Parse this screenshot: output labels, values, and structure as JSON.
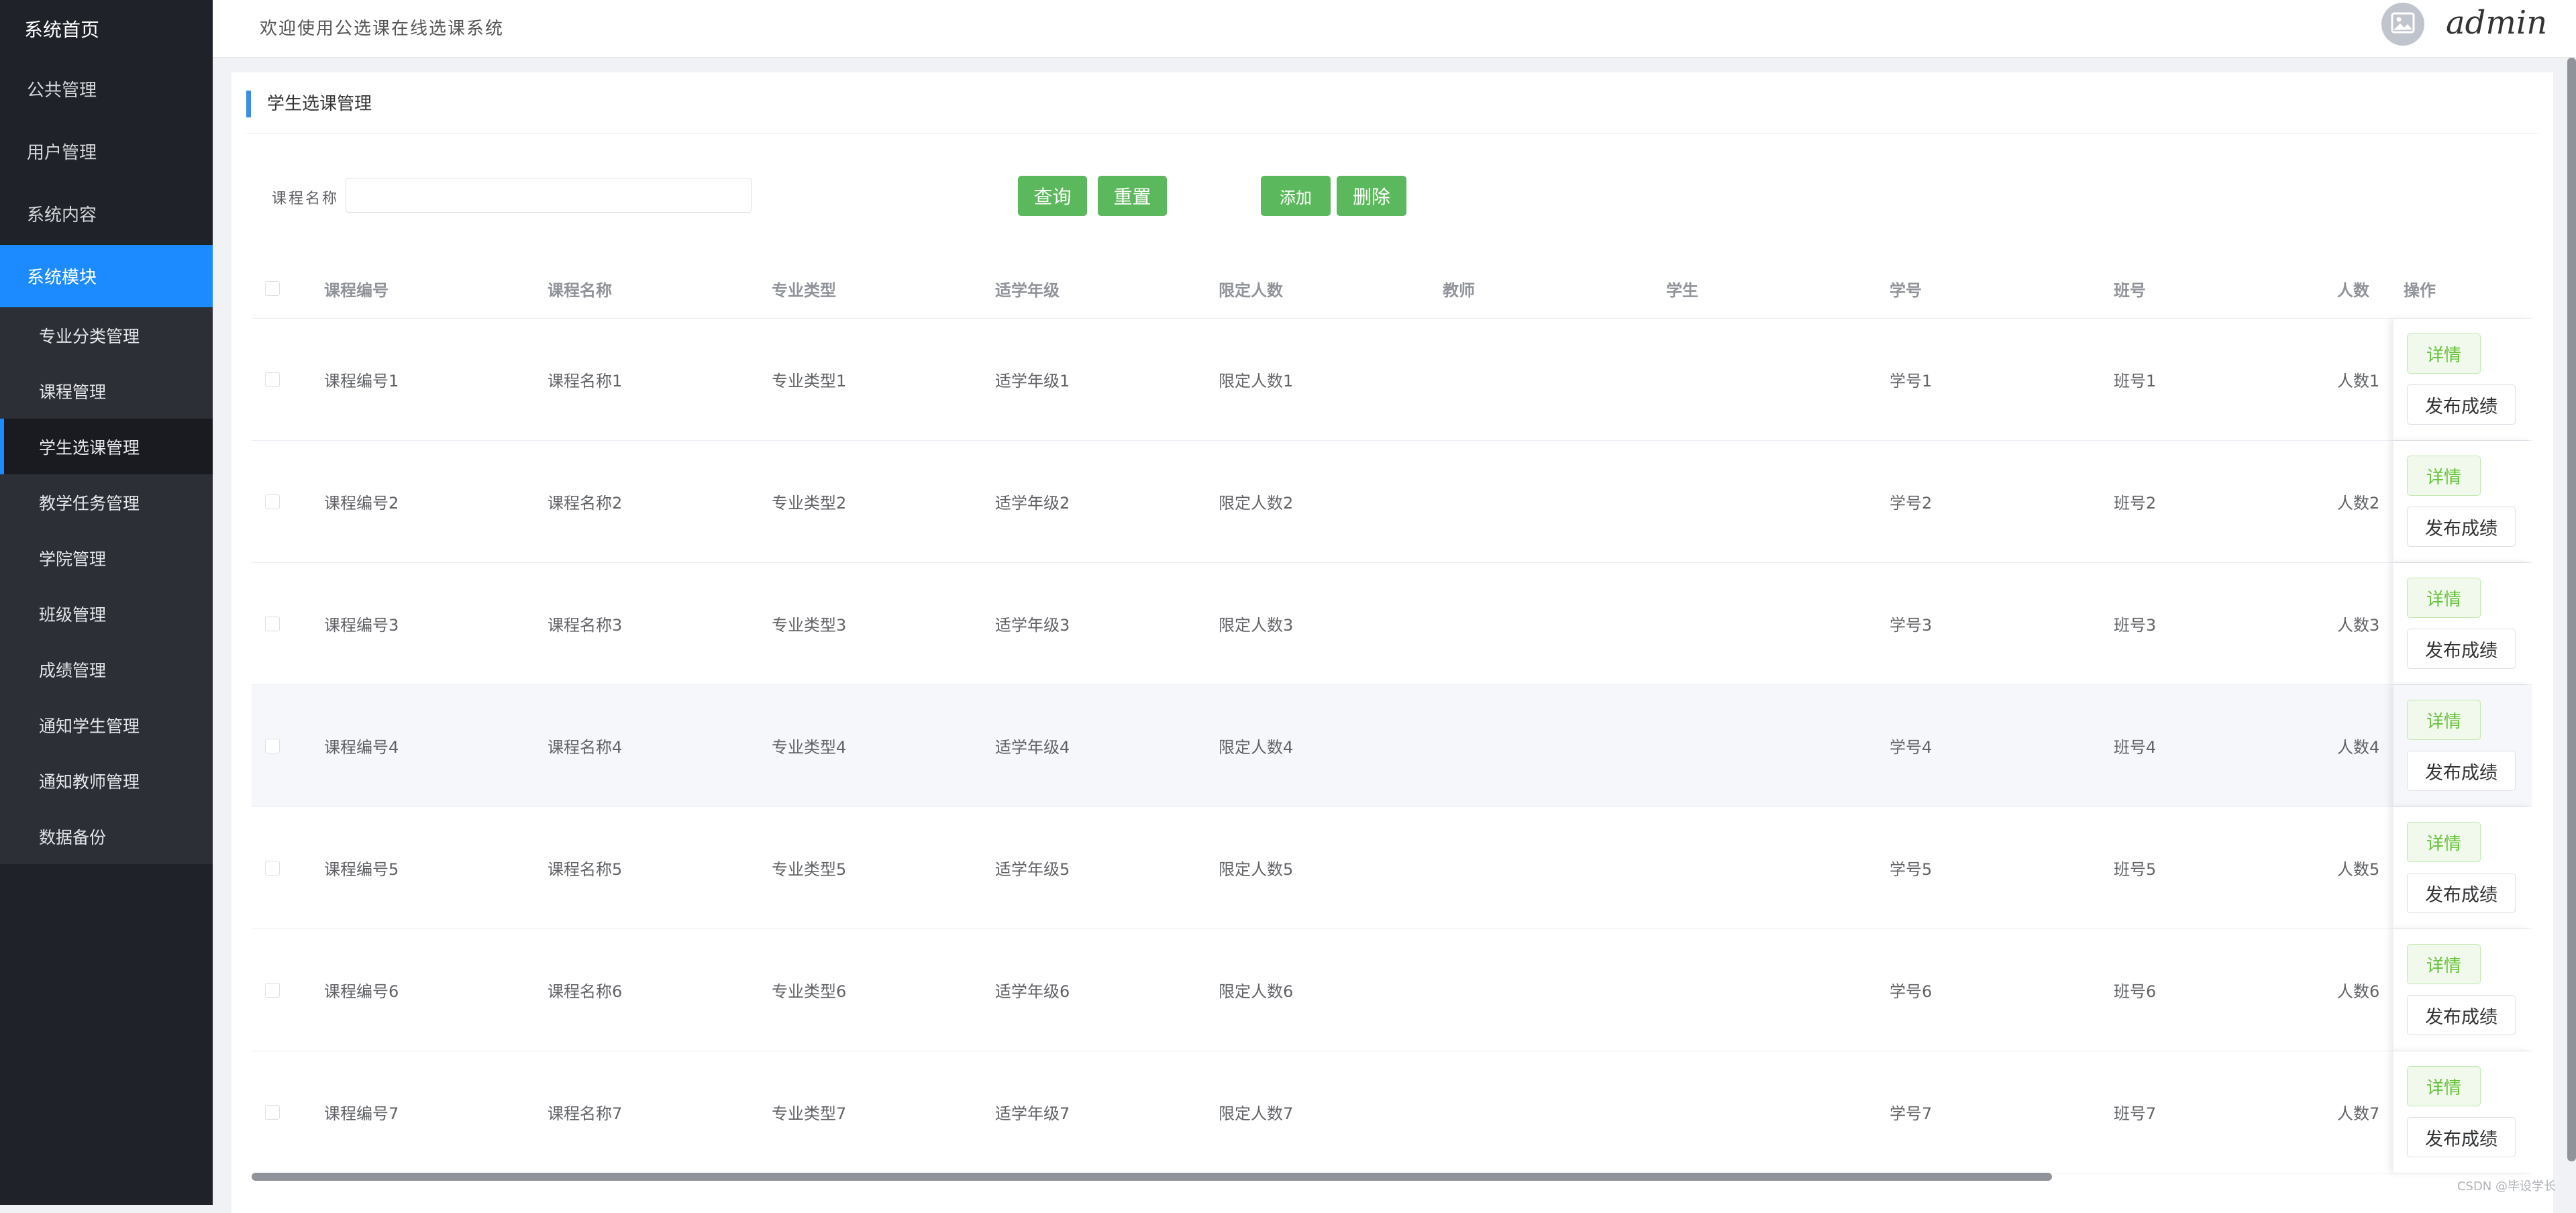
{
  "sidebar": {
    "home": "系统首页",
    "items": [
      {
        "label": "公共管理"
      },
      {
        "label": "用户管理"
      },
      {
        "label": "系统内容"
      },
      {
        "label": "系统模块"
      }
    ],
    "submenu": [
      {
        "label": "专业分类管理"
      },
      {
        "label": "课程管理"
      },
      {
        "label": "学生选课管理"
      },
      {
        "label": "教学任务管理"
      },
      {
        "label": "学院管理"
      },
      {
        "label": "班级管理"
      },
      {
        "label": "成绩管理"
      },
      {
        "label": "通知学生管理"
      },
      {
        "label": "通知教师管理"
      },
      {
        "label": "数据备份"
      }
    ]
  },
  "header": {
    "welcome": "欢迎使用公选课在线选课系统",
    "username": "admin",
    "avatar_icon": "image-icon"
  },
  "page": {
    "title": "学生选课管理"
  },
  "search": {
    "label": "课程名称",
    "value": "",
    "query_label": "查询",
    "reset_label": "重置",
    "add_label": "添加",
    "delete_label": "删除"
  },
  "table": {
    "headers": [
      "课程编号",
      "课程名称",
      "专业类型",
      "适学年级",
      "限定人数",
      "教师",
      "学生",
      "学号",
      "班号",
      "人数",
      "操作"
    ],
    "rows": [
      [
        "课程编号1",
        "课程名称1",
        "专业类型1",
        "适学年级1",
        "限定人数1",
        "",
        "",
        "学号1",
        "班号1",
        "人数1"
      ],
      [
        "课程编号2",
        "课程名称2",
        "专业类型2",
        "适学年级2",
        "限定人数2",
        "",
        "",
        "学号2",
        "班号2",
        "人数2"
      ],
      [
        "课程编号3",
        "课程名称3",
        "专业类型3",
        "适学年级3",
        "限定人数3",
        "",
        "",
        "学号3",
        "班号3",
        "人数3"
      ],
      [
        "课程编号4",
        "课程名称4",
        "专业类型4",
        "适学年级4",
        "限定人数4",
        "",
        "",
        "学号4",
        "班号4",
        "人数4"
      ],
      [
        "课程编号5",
        "课程名称5",
        "专业类型5",
        "适学年级5",
        "限定人数5",
        "",
        "",
        "学号5",
        "班号5",
        "人数5"
      ],
      [
        "课程编号6",
        "课程名称6",
        "专业类型6",
        "适学年级6",
        "限定人数6",
        "",
        "",
        "学号6",
        "班号6",
        "人数6"
      ],
      [
        "课程编号7",
        "课程名称7",
        "专业类型7",
        "适学年级7",
        "限定人数7",
        "",
        "",
        "学号7",
        "班号7",
        "人数7"
      ]
    ],
    "detail_label": "详情",
    "publish_label": "发布成绩"
  },
  "footer": {
    "watermark": "CSDN @毕设学长"
  },
  "colors": {
    "sidebar_bg": "#1f2229",
    "active_blue": "#1b8bff",
    "success_green": "#5cb85c"
  }
}
